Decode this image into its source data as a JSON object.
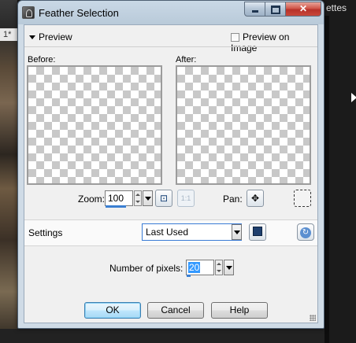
{
  "background": {
    "left_tab_text": "1*",
    "right_menu_text": "ettes"
  },
  "window": {
    "title": "Feather Selection",
    "controls": {
      "minimize": "",
      "maximize": "",
      "close": "✕"
    }
  },
  "preview": {
    "section_label": "Preview",
    "preview_on_image_label": "Preview on Image",
    "preview_on_image_checked": false,
    "before_label": "Before:",
    "after_label": "After:",
    "zoom_label": "Zoom:",
    "zoom_value": "100",
    "actual_size_label": "1:1",
    "pan_label": "Pan:",
    "pan_icon": "move-icon",
    "proof_icon": "marquee-icon"
  },
  "settings": {
    "label": "Settings",
    "preset_value": "Last Used",
    "save_icon": "save-preset-icon",
    "reset_icon": "reset-icon"
  },
  "options": {
    "pixels_label": "Number of pixels:",
    "pixels_value": "20"
  },
  "buttons": {
    "ok": "OK",
    "cancel": "Cancel",
    "help": "Help"
  },
  "colors": {
    "accent": "#3b7fd1",
    "close": "#c8483b",
    "checker": "#c8c8c8"
  }
}
